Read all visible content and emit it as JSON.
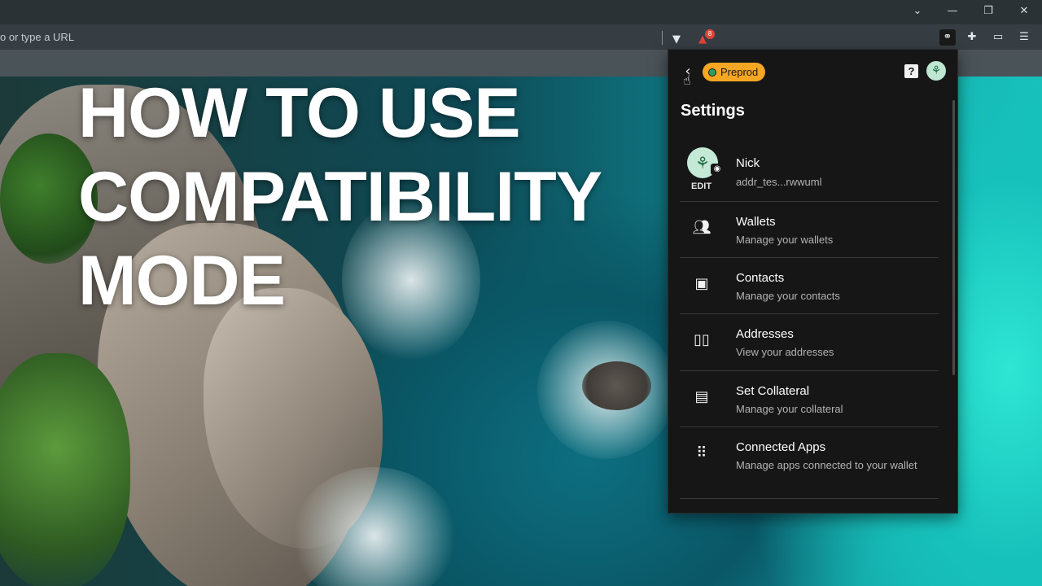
{
  "browser": {
    "omnibox_text": "o or type a URL",
    "window_controls": [
      "⌄",
      "—",
      "❐",
      "✕"
    ],
    "extension_badge_count": "8"
  },
  "headline": {
    "lines": [
      "HOW TO USE",
      "COMPATIBILITY",
      "MODE"
    ]
  },
  "popup": {
    "network_label": "Preprod",
    "help_label": "?",
    "title": "Settings",
    "profile": {
      "name": "Nick",
      "address": "addr_tes...rwwuml",
      "edit_label": "EDIT"
    },
    "items": [
      {
        "title": "Wallets",
        "subtitle": "Manage your wallets",
        "icon": "people-icon"
      },
      {
        "title": "Contacts",
        "subtitle": "Manage your contacts",
        "icon": "contacts-icon"
      },
      {
        "title": "Addresses",
        "subtitle": "View your addresses",
        "icon": "book-icon"
      },
      {
        "title": "Set Collateral",
        "subtitle": "Manage your collateral",
        "icon": "list-icon"
      },
      {
        "title": "Connected Apps",
        "subtitle": "Manage apps connected to your wallet",
        "icon": "apps-grid-icon"
      }
    ],
    "colors": {
      "background": "#161616",
      "network_badge": "#f5a623",
      "avatar": "#c4ead7"
    }
  }
}
